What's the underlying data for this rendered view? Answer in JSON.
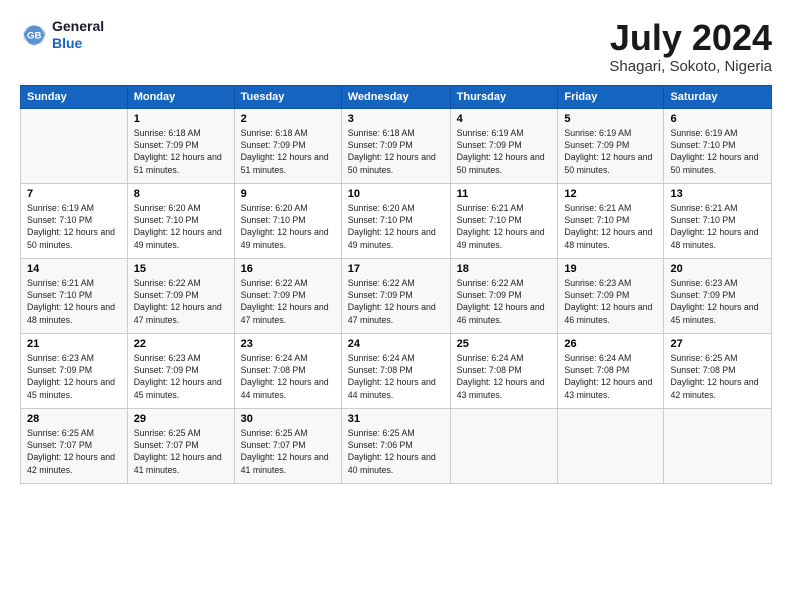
{
  "logo": {
    "line1": "General",
    "line2": "Blue"
  },
  "title": "July 2024",
  "location": "Shagari, Sokoto, Nigeria",
  "columns": [
    "Sunday",
    "Monday",
    "Tuesday",
    "Wednesday",
    "Thursday",
    "Friday",
    "Saturday"
  ],
  "weeks": [
    [
      {
        "day": "",
        "sunrise": "",
        "sunset": "",
        "daylight": ""
      },
      {
        "day": "1",
        "sunrise": "Sunrise: 6:18 AM",
        "sunset": "Sunset: 7:09 PM",
        "daylight": "Daylight: 12 hours and 51 minutes."
      },
      {
        "day": "2",
        "sunrise": "Sunrise: 6:18 AM",
        "sunset": "Sunset: 7:09 PM",
        "daylight": "Daylight: 12 hours and 51 minutes."
      },
      {
        "day": "3",
        "sunrise": "Sunrise: 6:18 AM",
        "sunset": "Sunset: 7:09 PM",
        "daylight": "Daylight: 12 hours and 50 minutes."
      },
      {
        "day": "4",
        "sunrise": "Sunrise: 6:19 AM",
        "sunset": "Sunset: 7:09 PM",
        "daylight": "Daylight: 12 hours and 50 minutes."
      },
      {
        "day": "5",
        "sunrise": "Sunrise: 6:19 AM",
        "sunset": "Sunset: 7:09 PM",
        "daylight": "Daylight: 12 hours and 50 minutes."
      },
      {
        "day": "6",
        "sunrise": "Sunrise: 6:19 AM",
        "sunset": "Sunset: 7:10 PM",
        "daylight": "Daylight: 12 hours and 50 minutes."
      }
    ],
    [
      {
        "day": "7",
        "sunrise": "Sunrise: 6:19 AM",
        "sunset": "Sunset: 7:10 PM",
        "daylight": "Daylight: 12 hours and 50 minutes."
      },
      {
        "day": "8",
        "sunrise": "Sunrise: 6:20 AM",
        "sunset": "Sunset: 7:10 PM",
        "daylight": "Daylight: 12 hours and 49 minutes."
      },
      {
        "day": "9",
        "sunrise": "Sunrise: 6:20 AM",
        "sunset": "Sunset: 7:10 PM",
        "daylight": "Daylight: 12 hours and 49 minutes."
      },
      {
        "day": "10",
        "sunrise": "Sunrise: 6:20 AM",
        "sunset": "Sunset: 7:10 PM",
        "daylight": "Daylight: 12 hours and 49 minutes."
      },
      {
        "day": "11",
        "sunrise": "Sunrise: 6:21 AM",
        "sunset": "Sunset: 7:10 PM",
        "daylight": "Daylight: 12 hours and 49 minutes."
      },
      {
        "day": "12",
        "sunrise": "Sunrise: 6:21 AM",
        "sunset": "Sunset: 7:10 PM",
        "daylight": "Daylight: 12 hours and 48 minutes."
      },
      {
        "day": "13",
        "sunrise": "Sunrise: 6:21 AM",
        "sunset": "Sunset: 7:10 PM",
        "daylight": "Daylight: 12 hours and 48 minutes."
      }
    ],
    [
      {
        "day": "14",
        "sunrise": "Sunrise: 6:21 AM",
        "sunset": "Sunset: 7:10 PM",
        "daylight": "Daylight: 12 hours and 48 minutes."
      },
      {
        "day": "15",
        "sunrise": "Sunrise: 6:22 AM",
        "sunset": "Sunset: 7:09 PM",
        "daylight": "Daylight: 12 hours and 47 minutes."
      },
      {
        "day": "16",
        "sunrise": "Sunrise: 6:22 AM",
        "sunset": "Sunset: 7:09 PM",
        "daylight": "Daylight: 12 hours and 47 minutes."
      },
      {
        "day": "17",
        "sunrise": "Sunrise: 6:22 AM",
        "sunset": "Sunset: 7:09 PM",
        "daylight": "Daylight: 12 hours and 47 minutes."
      },
      {
        "day": "18",
        "sunrise": "Sunrise: 6:22 AM",
        "sunset": "Sunset: 7:09 PM",
        "daylight": "Daylight: 12 hours and 46 minutes."
      },
      {
        "day": "19",
        "sunrise": "Sunrise: 6:23 AM",
        "sunset": "Sunset: 7:09 PM",
        "daylight": "Daylight: 12 hours and 46 minutes."
      },
      {
        "day": "20",
        "sunrise": "Sunrise: 6:23 AM",
        "sunset": "Sunset: 7:09 PM",
        "daylight": "Daylight: 12 hours and 45 minutes."
      }
    ],
    [
      {
        "day": "21",
        "sunrise": "Sunrise: 6:23 AM",
        "sunset": "Sunset: 7:09 PM",
        "daylight": "Daylight: 12 hours and 45 minutes."
      },
      {
        "day": "22",
        "sunrise": "Sunrise: 6:23 AM",
        "sunset": "Sunset: 7:09 PM",
        "daylight": "Daylight: 12 hours and 45 minutes."
      },
      {
        "day": "23",
        "sunrise": "Sunrise: 6:24 AM",
        "sunset": "Sunset: 7:08 PM",
        "daylight": "Daylight: 12 hours and 44 minutes."
      },
      {
        "day": "24",
        "sunrise": "Sunrise: 6:24 AM",
        "sunset": "Sunset: 7:08 PM",
        "daylight": "Daylight: 12 hours and 44 minutes."
      },
      {
        "day": "25",
        "sunrise": "Sunrise: 6:24 AM",
        "sunset": "Sunset: 7:08 PM",
        "daylight": "Daylight: 12 hours and 43 minutes."
      },
      {
        "day": "26",
        "sunrise": "Sunrise: 6:24 AM",
        "sunset": "Sunset: 7:08 PM",
        "daylight": "Daylight: 12 hours and 43 minutes."
      },
      {
        "day": "27",
        "sunrise": "Sunrise: 6:25 AM",
        "sunset": "Sunset: 7:08 PM",
        "daylight": "Daylight: 12 hours and 42 minutes."
      }
    ],
    [
      {
        "day": "28",
        "sunrise": "Sunrise: 6:25 AM",
        "sunset": "Sunset: 7:07 PM",
        "daylight": "Daylight: 12 hours and 42 minutes."
      },
      {
        "day": "29",
        "sunrise": "Sunrise: 6:25 AM",
        "sunset": "Sunset: 7:07 PM",
        "daylight": "Daylight: 12 hours and 41 minutes."
      },
      {
        "day": "30",
        "sunrise": "Sunrise: 6:25 AM",
        "sunset": "Sunset: 7:07 PM",
        "daylight": "Daylight: 12 hours and 41 minutes."
      },
      {
        "day": "31",
        "sunrise": "Sunrise: 6:25 AM",
        "sunset": "Sunset: 7:06 PM",
        "daylight": "Daylight: 12 hours and 40 minutes."
      },
      {
        "day": "",
        "sunrise": "",
        "sunset": "",
        "daylight": ""
      },
      {
        "day": "",
        "sunrise": "",
        "sunset": "",
        "daylight": ""
      },
      {
        "day": "",
        "sunrise": "",
        "sunset": "",
        "daylight": ""
      }
    ]
  ]
}
